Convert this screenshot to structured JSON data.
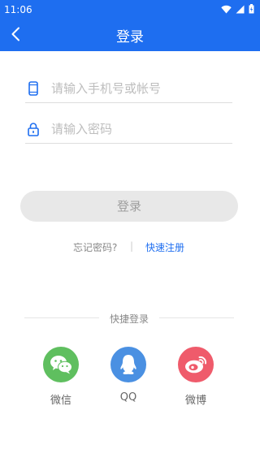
{
  "status_bar": {
    "time": "11:06"
  },
  "header": {
    "title": "登录"
  },
  "form": {
    "account_placeholder": "请输入手机号或帐号",
    "account_value": "",
    "password_placeholder": "请输入密码",
    "password_value": "",
    "login_label": "登录"
  },
  "links": {
    "forgot": "忘记密码?",
    "separator": "|",
    "register": "快速注册"
  },
  "quick_login": {
    "label": "快捷登录",
    "options": [
      {
        "label": "微信",
        "icon": "wechat-icon",
        "color": "#5fbf5f"
      },
      {
        "label": "QQ",
        "icon": "qq-icon",
        "color": "#4a90e2"
      },
      {
        "label": "微博",
        "icon": "weibo-icon",
        "color": "#ef5b6b"
      }
    ]
  },
  "colors": {
    "primary": "#1e6ef0",
    "button_disabled": "#e8e8e8"
  }
}
